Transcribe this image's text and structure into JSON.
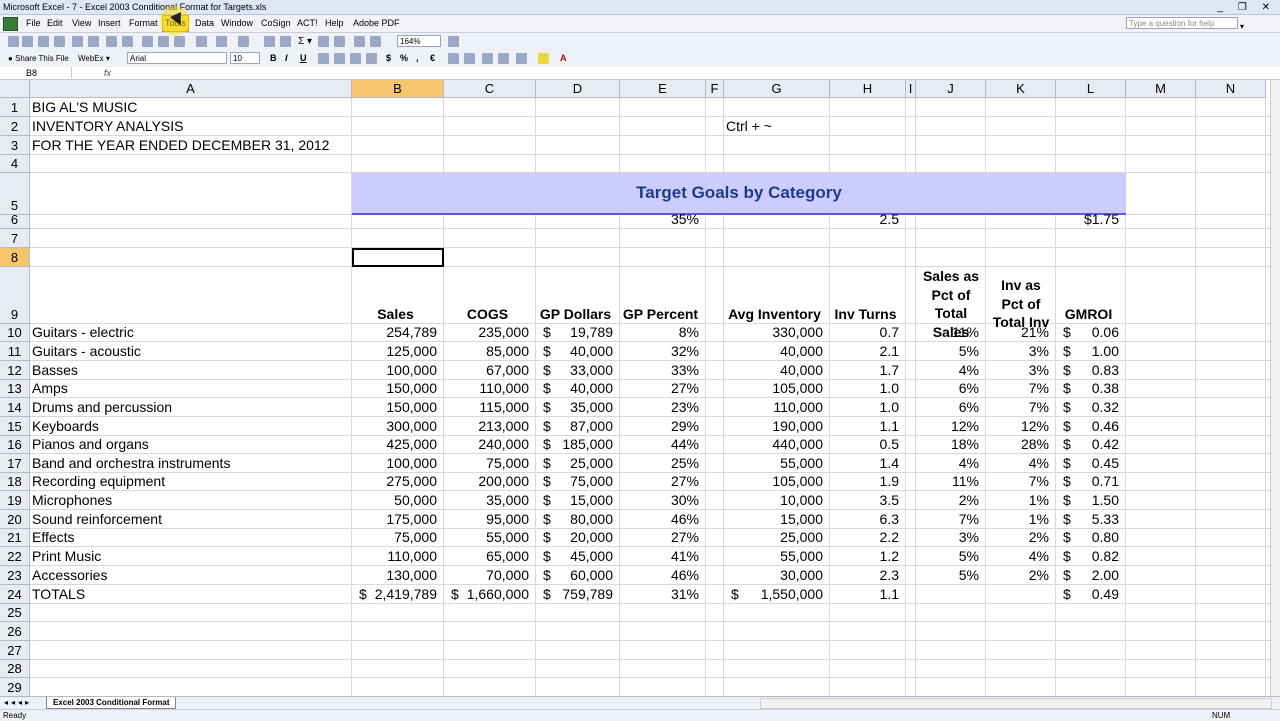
{
  "window": {
    "title": "Microsoft Excel - 7 - Excel 2003 Conditional Format for Targets.xls",
    "controls": "_ ❐ ✕"
  },
  "menu": [
    "File",
    "Edit",
    "View",
    "Insert",
    "Format",
    "Tools",
    "Data",
    "Window",
    "CoSign",
    "ACT!",
    "Help",
    "Adobe PDF"
  ],
  "help_placeholder": "Type a question for help",
  "toolbar": {
    "zoom": "164%",
    "share": "Share This File",
    "webex": "WebEx",
    "font": "Arial",
    "size": "10"
  },
  "formula_bar": {
    "name_box": "B8",
    "fx": "fx",
    "content": ""
  },
  "columns": [
    "A",
    "B",
    "C",
    "D",
    "E",
    "F",
    "G",
    "H",
    "I",
    "J",
    "K",
    "L",
    "M",
    "N"
  ],
  "rows": [
    "1",
    "2",
    "3",
    "4",
    "5",
    "6",
    "7",
    "8",
    "9",
    "10",
    "11",
    "12",
    "13",
    "14",
    "15",
    "16",
    "17",
    "18",
    "19",
    "20",
    "21",
    "22",
    "23",
    "24",
    "25",
    "26",
    "27",
    "28",
    "29"
  ],
  "sheet": {
    "title1": "BIG AL'S MUSIC",
    "title2": "INVENTORY ANALYSIS",
    "title3": "FOR THE YEAR ENDED DECEMBER 31, 2012",
    "note": "Ctrl + ~",
    "banner": "Target Goals by Category",
    "targets": {
      "gp_pct": "35%",
      "inv_turns": "2.5",
      "gmroi": "$1.75"
    },
    "headers": {
      "sales": "Sales",
      "cogs": "COGS",
      "gp_dollars": "GP Dollars",
      "gp_pct": "GP Percent",
      "avg_inv": "Avg Inventory",
      "inv_turns": "Inv Turns",
      "sales_pct": [
        "Sales as",
        "Pct of",
        "Total",
        "Sales"
      ],
      "inv_pct": [
        "Inv as",
        "Pct of",
        "Total Inv"
      ],
      "gmroi": "GMROI"
    },
    "data_rows": [
      {
        "cat": "Guitars - electric",
        "sales": "254,789",
        "cogs": "235,000",
        "gp": "19,789",
        "gpp": "8%",
        "inv": "330,000",
        "turns": "0.7",
        "spct": "11%",
        "ipct": "21%",
        "gmroi": "0.06"
      },
      {
        "cat": "Guitars - acoustic",
        "sales": "125,000",
        "cogs": "85,000",
        "gp": "40,000",
        "gpp": "32%",
        "inv": "40,000",
        "turns": "2.1",
        "spct": "5%",
        "ipct": "3%",
        "gmroi": "1.00"
      },
      {
        "cat": "Basses",
        "sales": "100,000",
        "cogs": "67,000",
        "gp": "33,000",
        "gpp": "33%",
        "inv": "40,000",
        "turns": "1.7",
        "spct": "4%",
        "ipct": "3%",
        "gmroi": "0.83"
      },
      {
        "cat": "Amps",
        "sales": "150,000",
        "cogs": "110,000",
        "gp": "40,000",
        "gpp": "27%",
        "inv": "105,000",
        "turns": "1.0",
        "spct": "6%",
        "ipct": "7%",
        "gmroi": "0.38"
      },
      {
        "cat": "Drums and percussion",
        "sales": "150,000",
        "cogs": "115,000",
        "gp": "35,000",
        "gpp": "23%",
        "inv": "110,000",
        "turns": "1.0",
        "spct": "6%",
        "ipct": "7%",
        "gmroi": "0.32"
      },
      {
        "cat": "Keyboards",
        "sales": "300,000",
        "cogs": "213,000",
        "gp": "87,000",
        "gpp": "29%",
        "inv": "190,000",
        "turns": "1.1",
        "spct": "12%",
        "ipct": "12%",
        "gmroi": "0.46"
      },
      {
        "cat": "Pianos and organs",
        "sales": "425,000",
        "cogs": "240,000",
        "gp": "185,000",
        "gpp": "44%",
        "inv": "440,000",
        "turns": "0.5",
        "spct": "18%",
        "ipct": "28%",
        "gmroi": "0.42"
      },
      {
        "cat": "Band and orchestra instruments",
        "sales": "100,000",
        "cogs": "75,000",
        "gp": "25,000",
        "gpp": "25%",
        "inv": "55,000",
        "turns": "1.4",
        "spct": "4%",
        "ipct": "4%",
        "gmroi": "0.45"
      },
      {
        "cat": "Recording equipment",
        "sales": "275,000",
        "cogs": "200,000",
        "gp": "75,000",
        "gpp": "27%",
        "inv": "105,000",
        "turns": "1.9",
        "spct": "11%",
        "ipct": "7%",
        "gmroi": "0.71"
      },
      {
        "cat": "Microphones",
        "sales": "50,000",
        "cogs": "35,000",
        "gp": "15,000",
        "gpp": "30%",
        "inv": "10,000",
        "turns": "3.5",
        "spct": "2%",
        "ipct": "1%",
        "gmroi": "1.50"
      },
      {
        "cat": "Sound reinforcement",
        "sales": "175,000",
        "cogs": "95,000",
        "gp": "80,000",
        "gpp": "46%",
        "inv": "15,000",
        "turns": "6.3",
        "spct": "7%",
        "ipct": "1%",
        "gmroi": "5.33"
      },
      {
        "cat": "Effects",
        "sales": "75,000",
        "cogs": "55,000",
        "gp": "20,000",
        "gpp": "27%",
        "inv": "25,000",
        "turns": "2.2",
        "spct": "3%",
        "ipct": "2%",
        "gmroi": "0.80"
      },
      {
        "cat": "Print Music",
        "sales": "110,000",
        "cogs": "65,000",
        "gp": "45,000",
        "gpp": "41%",
        "inv": "55,000",
        "turns": "1.2",
        "spct": "5%",
        "ipct": "4%",
        "gmroi": "0.82"
      },
      {
        "cat": "Accessories",
        "sales": "130,000",
        "cogs": "70,000",
        "gp": "60,000",
        "gpp": "46%",
        "inv": "30,000",
        "turns": "2.3",
        "spct": "5%",
        "ipct": "2%",
        "gmroi": "2.00"
      }
    ],
    "totals": {
      "cat": "TOTALS",
      "sales": "2,419,789",
      "cogs": "1,660,000",
      "gp": "759,789",
      "gpp": "31%",
      "inv": "1,550,000",
      "turns": "1.1",
      "gmroi": "0.49"
    },
    "currency": "$"
  },
  "sheet_tab": "Excel 2003 Conditional Format",
  "status": {
    "left": "Ready",
    "right": "NUM"
  }
}
